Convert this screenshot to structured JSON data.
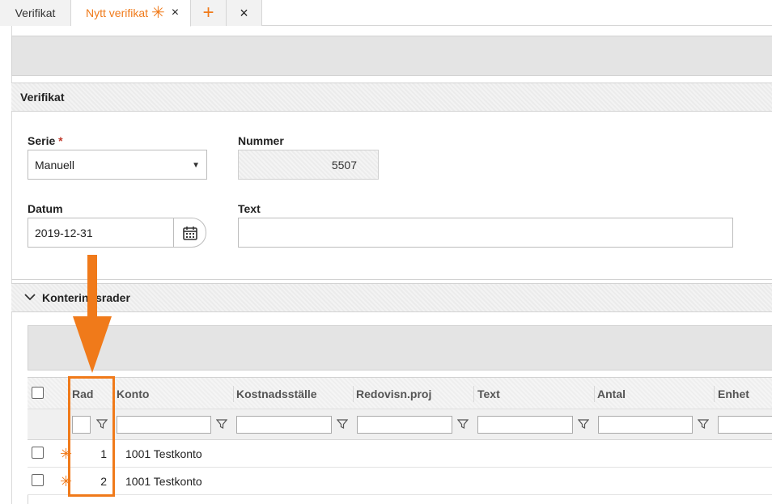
{
  "tabs": [
    {
      "label": "Verifikat"
    },
    {
      "label": "Nytt verifikat",
      "modified_marker": "✳",
      "close": "×"
    },
    {
      "label": "+"
    },
    {
      "label": "×"
    }
  ],
  "verifikat_section": {
    "title": "Verifikat",
    "serie": {
      "label": "Serie",
      "required_marker": "*",
      "value": "Manuell"
    },
    "nummer": {
      "label": "Nummer",
      "value": "5507"
    },
    "datum": {
      "label": "Datum",
      "value": "2019-12-31"
    },
    "text": {
      "label": "Text",
      "value": ""
    }
  },
  "kontering_section": {
    "title": "Konteringsrader",
    "columns": [
      "Rad",
      "Konto",
      "Kostnadsställe",
      "Redovisn.proj",
      "Text",
      "Antal",
      "Enhet"
    ],
    "rows": [
      {
        "rad": "1",
        "konto": "1001  Testkonto"
      },
      {
        "rad": "2",
        "konto": "1001  Testkonto"
      }
    ]
  },
  "colors": {
    "accent": "#f07a1a",
    "required": "#c0392b"
  },
  "annotation": {
    "arrow": "down-arrow-icon",
    "highlight": "rad-column-highlight"
  }
}
